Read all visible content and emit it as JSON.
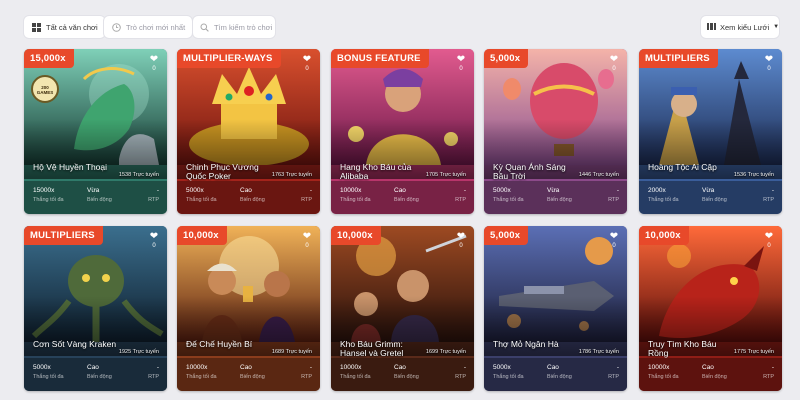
{
  "filters": {
    "all_games": "Tất cả văn chơi",
    "new_games": "Trò chơi mới nhất",
    "search_placeholder": "Tìm kiếm trò chơi",
    "view_mode": "Xem kiểu Lưới"
  },
  "labels": {
    "max_win": "Thắng tối đa",
    "volatility": "Biến động",
    "rtp": "RTP",
    "online_suffix": "Trực tuyến"
  },
  "games": [
    {
      "badge": "15,000x",
      "title": "Hộ Vệ Huyền Thoại",
      "online": "1538 Trực tuyến",
      "favs": "0",
      "max": "15000x",
      "vol": "Vừa",
      "rtp": "-",
      "art": "dragon",
      "extra": "200 GAMES"
    },
    {
      "badge": "MULTIPLIER-WAYS",
      "title": "Chinh Phục Vương Quốc Poker",
      "online": "1763 Trực tuyến",
      "favs": "0",
      "max": "5000x",
      "vol": "Cao",
      "rtp": "-",
      "art": "crown"
    },
    {
      "badge": "BONUS FEATURE",
      "title": "Hang Kho Báu của Alibaba",
      "online": "1705 Trực tuyến",
      "favs": "0",
      "max": "10000x",
      "vol": "Cao",
      "rtp": "-",
      "art": "genie"
    },
    {
      "badge": "5,000x",
      "title": "Kỳ Quan Ánh Sáng Bầu Trời",
      "online": "1446 Trực tuyến",
      "favs": "0",
      "max": "5000x",
      "vol": "Vừa",
      "rtp": "-",
      "art": "balloon"
    },
    {
      "badge": "MULTIPLIERS",
      "title": "Hoàng Tộc Ai Cập",
      "online": "1536 Trực tuyến",
      "favs": "0",
      "max": "2000x",
      "vol": "Vừa",
      "rtp": "-",
      "art": "egypt"
    },
    {
      "badge": "MULTIPLIERS",
      "title": "Cơn Sốt Vàng Kraken",
      "online": "1925 Trực tuyến",
      "favs": "0",
      "max": "5000x",
      "vol": "Cao",
      "rtp": "-",
      "art": "kraken"
    },
    {
      "badge": "10,000x",
      "title": "Đế Chế Huyền Bí",
      "online": "1689 Trực tuyến",
      "favs": "0",
      "max": "10000x",
      "vol": "Cao",
      "rtp": "-",
      "art": "empire"
    },
    {
      "badge": "10,000x",
      "title": "Kho Báu Grimm: Hansel và Gretel",
      "online": "1699 Trực tuyến",
      "favs": "0",
      "max": "10000x",
      "vol": "Cao",
      "rtp": "-",
      "art": "grimm"
    },
    {
      "badge": "5,000x",
      "title": "Thợ Mỏ Ngân Hà",
      "online": "1786 Trực tuyến",
      "favs": "0",
      "max": "5000x",
      "vol": "Cao",
      "rtp": "-",
      "art": "space"
    },
    {
      "badge": "10,000x",
      "title": "Truy Tìm Kho Báu Rồng",
      "online": "1775 Trực tuyến",
      "favs": "0",
      "max": "10000x",
      "vol": "Cao",
      "rtp": "-",
      "art": "reddragon"
    }
  ],
  "colors": {
    "badge": "#e8492a",
    "dragon": "#2f7a6a",
    "crown": "#a3231b",
    "genie": "#b8356b",
    "balloon": "#8c4a8a",
    "egypt": "#3a5d9a",
    "kraken": "#27425a",
    "empire": "#8a3c1c",
    "grimm": "#5a2a1a",
    "space": "#3b3f6a",
    "reddragon": "#8f1d16"
  }
}
